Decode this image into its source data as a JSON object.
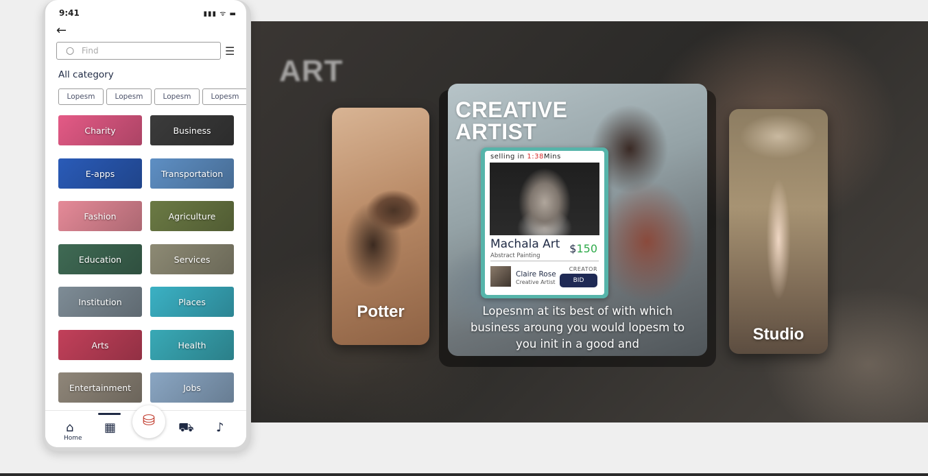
{
  "status": {
    "time": "9:41",
    "icons": "▮▮▮ ᯤ ▬"
  },
  "search": {
    "placeholder": "Find"
  },
  "section_title": "All category",
  "chips": [
    "Lopesm",
    "Lopesm",
    "Lopesm",
    "Lopesm"
  ],
  "categories": [
    {
      "label": "Charity",
      "color": "#e45a86"
    },
    {
      "label": "Business",
      "color": "#3b3b3b"
    },
    {
      "label": "E-apps",
      "color": "#2a5bb8"
    },
    {
      "label": "Transportation",
      "color": "#5e8fc4"
    },
    {
      "label": "Fashion",
      "color": "#e58a98"
    },
    {
      "label": "Agriculture",
      "color": "#6b7a44"
    },
    {
      "label": "Education",
      "color": "#3f6a54"
    },
    {
      "label": "Services",
      "color": "#8d8a74"
    },
    {
      "label": "Institution",
      "color": "#7e8c96"
    },
    {
      "label": "Places",
      "color": "#3bb1c4"
    },
    {
      "label": "Arts",
      "color": "#c2405a"
    },
    {
      "label": "Health",
      "color": "#39a9b6"
    },
    {
      "label": "Entertainment",
      "color": "#8f8679"
    },
    {
      "label": "Jobs",
      "color": "#8aa6c3"
    }
  ],
  "tabbar": {
    "home_label": "Home"
  },
  "hero": {
    "title": "ART",
    "left_card": "Potter",
    "right_card": "Studio",
    "main_heading_line1": "CREATIVE",
    "main_heading_line2": "ARTIST",
    "caption": "Lopesnm at its best of with which business aroung you would lopesm to you init in a good and"
  },
  "auction": {
    "selling_prefix": "selling in ",
    "time_value": "1:38",
    "time_unit": "Mins",
    "art_name": "Machala Art",
    "art_sub": "Abstract Painting",
    "currency": "$",
    "price": "150",
    "creator_tag": "CREATOR",
    "creator_name": "Claire Rose",
    "creator_role": "Creative Artist",
    "bid_label": "BID"
  }
}
